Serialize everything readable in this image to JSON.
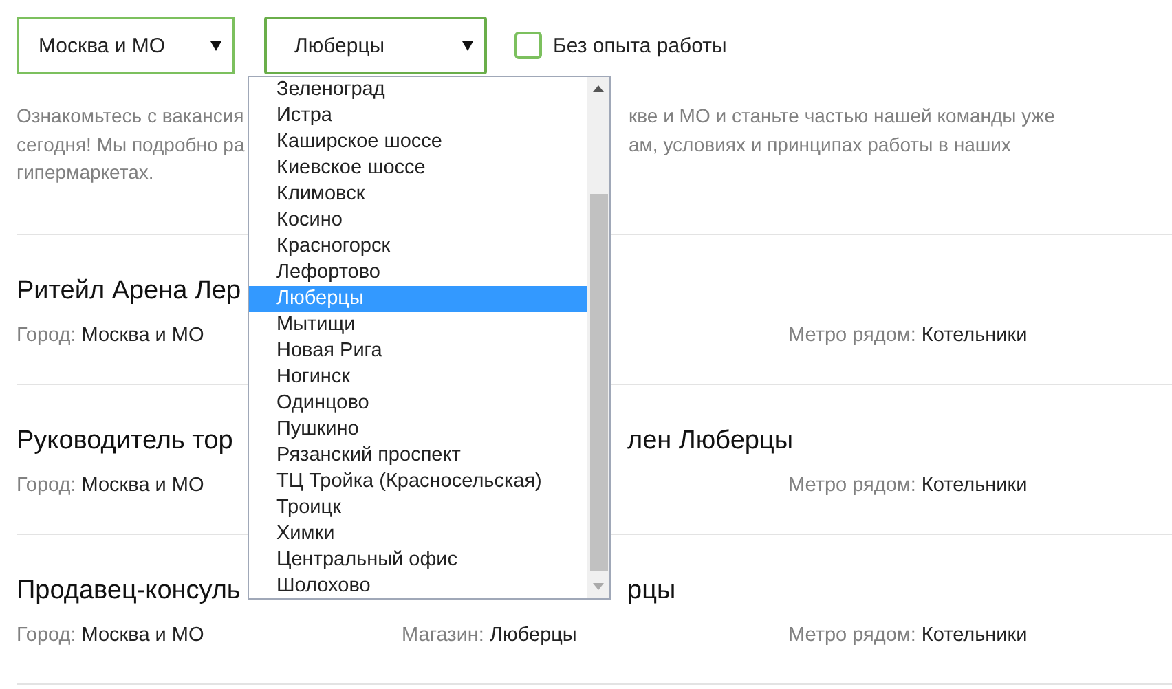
{
  "filters": {
    "region": {
      "value": "Москва и МО"
    },
    "city": {
      "value": "Люберцы",
      "expanded": true
    },
    "no_experience": {
      "label": "Без опыта работы",
      "checked": false
    }
  },
  "intro": [
    {
      "left": "Ознакомьтесь с вакансия",
      "right": "кве и МО и станьте частью нашей команды уже"
    },
    {
      "left": "сегодня! Мы подробно ра",
      "right": "ам, условиях и принципах работы в наших"
    },
    {
      "left": "гипермаркетах."
    }
  ],
  "vacancies": [
    {
      "title_left": "Ритейл Арена Лер",
      "city": {
        "label": "Город:",
        "value": "Москва и МО"
      },
      "metro": {
        "label": "Метро рядом:",
        "value": "Котельники"
      }
    },
    {
      "title_left": "Руководитель тор",
      "title_right": "лен Люберцы",
      "city": {
        "label": "Город:",
        "value": "Москва и МО"
      },
      "metro": {
        "label": "Метро рядом:",
        "value": "Котельники"
      }
    },
    {
      "title_left": "Продавец-консуль",
      "title_right": "рцы",
      "city": {
        "label": "Город:",
        "value": "Москва и МО"
      },
      "store": {
        "label": "Магазин:",
        "value": "Люберцы"
      },
      "metro": {
        "label": "Метро рядом:",
        "value": "Котельники"
      }
    }
  ],
  "city_dropdown": {
    "items": [
      {
        "label": "Зеленоград",
        "selected": false
      },
      {
        "label": "Истра",
        "selected": false
      },
      {
        "label": "Каширское шоссе",
        "selected": false
      },
      {
        "label": "Киевское шоссе",
        "selected": false
      },
      {
        "label": "Климовск",
        "selected": false
      },
      {
        "label": "Косино",
        "selected": false
      },
      {
        "label": "Красногорск",
        "selected": false
      },
      {
        "label": "Лефортово",
        "selected": false
      },
      {
        "label": "Люберцы",
        "selected": true
      },
      {
        "label": "Мытищи",
        "selected": false
      },
      {
        "label": "Новая Рига",
        "selected": false
      },
      {
        "label": "Ногинск",
        "selected": false
      },
      {
        "label": "Одинцово",
        "selected": false
      },
      {
        "label": "Пушкино",
        "selected": false
      },
      {
        "label": "Рязанский проспект",
        "selected": false
      },
      {
        "label": "ТЦ Тройка (Красносельская)",
        "selected": false
      },
      {
        "label": "Троицк",
        "selected": false
      },
      {
        "label": "Химки",
        "selected": false
      },
      {
        "label": "Центральный офис",
        "selected": false
      },
      {
        "label": "Шолохово",
        "selected": false
      }
    ]
  }
}
